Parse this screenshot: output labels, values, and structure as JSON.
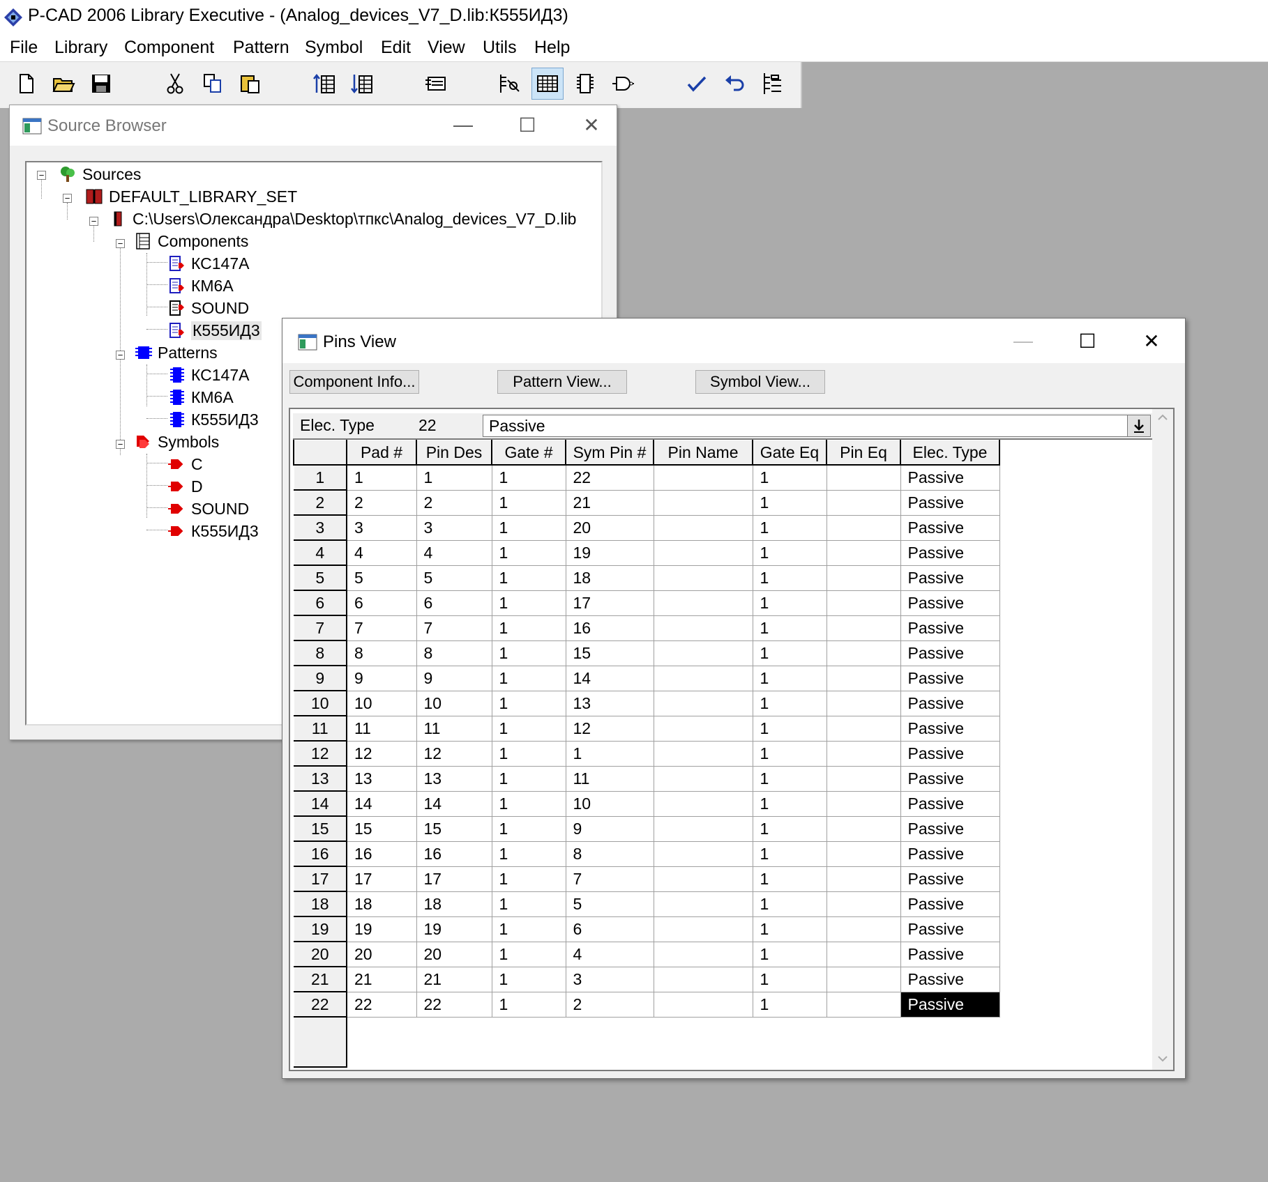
{
  "app": {
    "title": "P-CAD 2006 Library Executive - (Analog_devices_V7_D.lib:К555ИД3)"
  },
  "menu": [
    "File",
    "Library",
    "Component",
    "Pattern",
    "Symbol",
    "Edit",
    "View",
    "Utils",
    "Help"
  ],
  "toolbar": {
    "buttons": [
      "new-icon",
      "open-icon",
      "save-icon",
      "cut-icon",
      "copy-icon",
      "paste-icon",
      "sort-up-icon",
      "sort-down-icon",
      "component-info-icon",
      "pins-icon",
      "pins-view-icon",
      "pattern-view-icon",
      "symbol-view-icon",
      "validate-icon",
      "undo-icon",
      "tree-icon"
    ],
    "pressed": "pins-view-icon"
  },
  "source_browser": {
    "title": "Source Browser",
    "tree": {
      "root": "Sources",
      "library_set": "DEFAULT_LIBRARY_SET",
      "library_path": "C:\\Users\\Олександра\\Desktop\\тпкс\\Analog_devices_V7_D.lib",
      "components_label": "Components",
      "components": [
        "КС147А",
        "КМ6А",
        "SOUND",
        "К555ИД3"
      ],
      "patterns_label": "Patterns",
      "patterns": [
        "КС147А",
        "КМ6А",
        "К555ИД3"
      ],
      "symbols_label": "Symbols",
      "symbols": [
        "C",
        "D",
        "SOUND",
        "К555ИД3"
      ],
      "selected": "К555ИД3"
    }
  },
  "pins_view": {
    "title": "Pins View",
    "buttons": {
      "component_info": "Component Info...",
      "pattern_view": "Pattern View...",
      "symbol_view": "Symbol View..."
    },
    "edit_row": {
      "label": "Elec. Type",
      "row": "22",
      "value": "Passive"
    },
    "columns": [
      "Pad #",
      "Pin Des",
      "Gate #",
      "Sym Pin #",
      "Pin Name",
      "Gate Eq",
      "Pin Eq",
      "Elec. Type"
    ],
    "rows": [
      [
        "1",
        "1",
        "1",
        "22",
        "",
        "1",
        "",
        "Passive"
      ],
      [
        "2",
        "2",
        "1",
        "21",
        "",
        "1",
        "",
        "Passive"
      ],
      [
        "3",
        "3",
        "1",
        "20",
        "",
        "1",
        "",
        "Passive"
      ],
      [
        "4",
        "4",
        "1",
        "19",
        "",
        "1",
        "",
        "Passive"
      ],
      [
        "5",
        "5",
        "1",
        "18",
        "",
        "1",
        "",
        "Passive"
      ],
      [
        "6",
        "6",
        "1",
        "17",
        "",
        "1",
        "",
        "Passive"
      ],
      [
        "7",
        "7",
        "1",
        "16",
        "",
        "1",
        "",
        "Passive"
      ],
      [
        "8",
        "8",
        "1",
        "15",
        "",
        "1",
        "",
        "Passive"
      ],
      [
        "9",
        "9",
        "1",
        "14",
        "",
        "1",
        "",
        "Passive"
      ],
      [
        "10",
        "10",
        "1",
        "13",
        "",
        "1",
        "",
        "Passive"
      ],
      [
        "11",
        "11",
        "1",
        "12",
        "",
        "1",
        "",
        "Passive"
      ],
      [
        "12",
        "12",
        "1",
        "1",
        "",
        "1",
        "",
        "Passive"
      ],
      [
        "13",
        "13",
        "1",
        "11",
        "",
        "1",
        "",
        "Passive"
      ],
      [
        "14",
        "14",
        "1",
        "10",
        "",
        "1",
        "",
        "Passive"
      ],
      [
        "15",
        "15",
        "1",
        "9",
        "",
        "1",
        "",
        "Passive"
      ],
      [
        "16",
        "16",
        "1",
        "8",
        "",
        "1",
        "",
        "Passive"
      ],
      [
        "17",
        "17",
        "1",
        "7",
        "",
        "1",
        "",
        "Passive"
      ],
      [
        "18",
        "18",
        "1",
        "5",
        "",
        "1",
        "",
        "Passive"
      ],
      [
        "19",
        "19",
        "1",
        "6",
        "",
        "1",
        "",
        "Passive"
      ],
      [
        "20",
        "20",
        "1",
        "4",
        "",
        "1",
        "",
        "Passive"
      ],
      [
        "21",
        "21",
        "1",
        "3",
        "",
        "1",
        "",
        "Passive"
      ],
      [
        "22",
        "22",
        "1",
        "2",
        "",
        "1",
        "",
        "Passive"
      ]
    ],
    "selected_cell": {
      "row": 22,
      "column": "Elec. Type"
    }
  },
  "colors": {
    "desktop": "#ababab",
    "selection": "#000000",
    "component_icon": "#1f1fbf",
    "symbol_icon": "#e00000",
    "pattern_icon": "#0000ff"
  }
}
